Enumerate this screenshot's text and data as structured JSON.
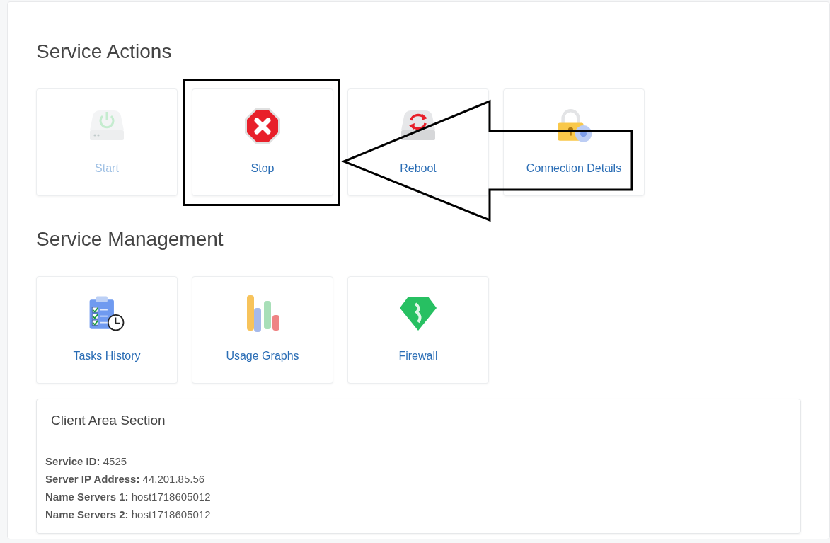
{
  "sections": [
    {
      "title": "Service Actions",
      "tiles": [
        {
          "label": "Start",
          "kind": "power",
          "disabled": true
        },
        {
          "label": "Stop",
          "kind": "stop",
          "disabled": false
        },
        {
          "label": "Reboot",
          "kind": "reboot",
          "disabled": false
        },
        {
          "label": "Connection Details",
          "kind": "lock",
          "disabled": false
        }
      ]
    },
    {
      "title": "Service Management",
      "tiles": [
        {
          "label": "Tasks History",
          "kind": "tasks",
          "disabled": false
        },
        {
          "label": "Usage Graphs",
          "kind": "graphs",
          "disabled": false
        },
        {
          "label": "Firewall",
          "kind": "firewall",
          "disabled": false
        }
      ]
    }
  ],
  "client_area": {
    "title": "Client Area Section",
    "rows": [
      {
        "label": "Service ID:",
        "value": "4525"
      },
      {
        "label": "Server IP Address:",
        "value": "44.201.85.56"
      },
      {
        "label": "Name Servers 1:",
        "value": "host1718605012"
      },
      {
        "label": "Name Servers 2:",
        "value": "host1718605012"
      }
    ]
  }
}
